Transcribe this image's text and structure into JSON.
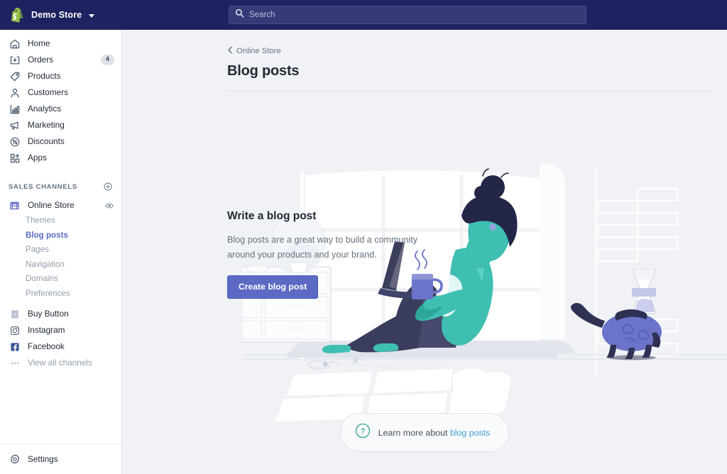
{
  "topbar": {
    "store_name": "Demo Store",
    "logo_icon": "shopify-bag-icon",
    "chevron_icon": "chevron-down-icon",
    "search": {
      "placeholder": "Search",
      "value": "",
      "icon": "search-icon"
    }
  },
  "sidebar": {
    "nav": [
      {
        "label": "Home",
        "icon": "home-icon",
        "badge": ""
      },
      {
        "label": "Orders",
        "icon": "orders-icon",
        "badge": "4"
      },
      {
        "label": "Products",
        "icon": "products-tag-icon",
        "badge": ""
      },
      {
        "label": "Customers",
        "icon": "customers-person-icon",
        "badge": ""
      },
      {
        "label": "Analytics",
        "icon": "analytics-bars-icon",
        "badge": ""
      },
      {
        "label": "Marketing",
        "icon": "marketing-megaphone-icon",
        "badge": ""
      },
      {
        "label": "Discounts",
        "icon": "discounts-percent-icon",
        "badge": ""
      },
      {
        "label": "Apps",
        "icon": "apps-grid-icon",
        "badge": ""
      }
    ],
    "sales_channels": {
      "title": "SALES CHANNELS",
      "add_icon": "plus-circle-icon",
      "online_store": {
        "label": "Online Store",
        "icon": "online-store-icon",
        "view_icon": "eye-icon"
      },
      "sub_items": [
        {
          "label": "Themes",
          "active": false
        },
        {
          "label": "Blog posts",
          "active": true
        },
        {
          "label": "Pages",
          "active": false
        },
        {
          "label": "Navigation",
          "active": false
        },
        {
          "label": "Domains",
          "active": false
        },
        {
          "label": "Preferences",
          "active": false
        }
      ],
      "channels": [
        {
          "label": "Buy Button",
          "icon": "buy-button-icon"
        },
        {
          "label": "Instagram",
          "icon": "instagram-icon"
        },
        {
          "label": "Facebook",
          "icon": "facebook-icon"
        }
      ],
      "view_all": {
        "label": "View all channels",
        "icon": "ellipsis-icon"
      }
    },
    "settings": {
      "label": "Settings",
      "icon": "gear-icon"
    }
  },
  "main": {
    "breadcrumb": {
      "label": "Online Store",
      "icon": "chevron-left-icon"
    },
    "page_title": "Blog posts",
    "empty_state": {
      "heading": "Write a blog post",
      "body": "Blog posts are a great way to build a community around your products and your brand.",
      "cta_label": "Create blog post",
      "illustration": "woman-on-window-sill-with-laptop-illustration"
    },
    "help": {
      "icon": "question-circle-icon",
      "text": "Learn more about ",
      "link_text": "blog posts"
    }
  },
  "colors": {
    "topbar_bg": "#1f2260",
    "sidebar_bg": "#ffffff",
    "main_bg": "#f0f2f5",
    "accent_indigo": "#5c6ac4",
    "link_blue": "#3f9fd1",
    "help_icon_teal": "#47a9a0",
    "logo_green": "#5a8c36",
    "text_dark": "#212b36",
    "text_muted": "#637381",
    "text_subdued": "#919eab",
    "illustration_teal": "#3fbfb2",
    "illustration_navy": "#3b3d5c",
    "illustration_purple": "#6b74c9"
  }
}
